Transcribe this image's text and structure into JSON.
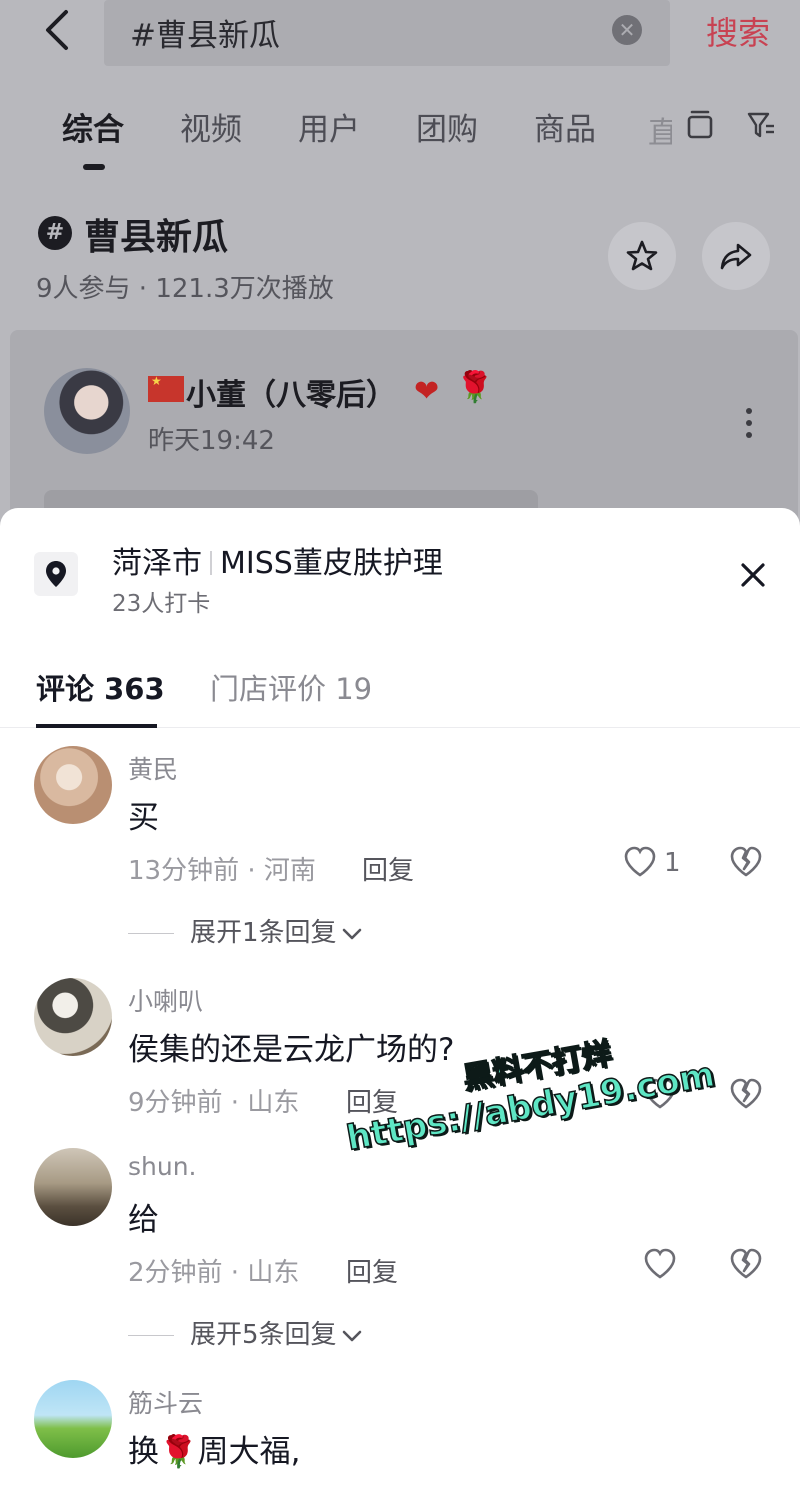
{
  "header": {
    "search_query": "#曹县新瓜",
    "search_button": "搜索",
    "brand_color": "#c84252"
  },
  "tabs": [
    {
      "label": "综合",
      "active": true
    },
    {
      "label": "视频",
      "active": false
    },
    {
      "label": "用户",
      "active": false
    },
    {
      "label": "团购",
      "active": false
    },
    {
      "label": "商品",
      "active": false
    }
  ],
  "tabs_overflow_label": "直",
  "topic": {
    "icon": "hashtag-icon",
    "title": "曹县新瓜",
    "stats": "9人参与 · 121.3万次播放"
  },
  "post": {
    "author": "小董（八零后）",
    "author_emoji": [
      "❤",
      "🌹"
    ],
    "time": "昨天19:42"
  },
  "sheet": {
    "place_city": "菏泽市",
    "place_name": "MISS董皮肤护理",
    "checkins": "23人打卡",
    "tabs": [
      {
        "label": "评论 363",
        "active": true
      },
      {
        "label": "门店评价 19",
        "active": false
      }
    ]
  },
  "comments": [
    {
      "user": "黄民",
      "text": "买",
      "meta": "13分钟前 · 河南",
      "reply_label": "回复",
      "likes": "1",
      "expand": "展开1条回复"
    },
    {
      "user": "小喇叭",
      "text": "侯集的还是云龙广场的?",
      "meta": "9分钟前 · 山东",
      "reply_label": "回复",
      "likes": "",
      "expand": ""
    },
    {
      "user": "shun.",
      "text": "给",
      "meta": "2分钟前 · 山东",
      "reply_label": "回复",
      "likes": "",
      "expand": "展开5条回复"
    },
    {
      "user": "筋斗云",
      "text_before": "换",
      "text_emoji": "🌹",
      "text_after": "周大福,",
      "meta": "",
      "reply_label": "",
      "likes": "",
      "expand": ""
    }
  ],
  "watermark": {
    "line1": "黑料不打烊",
    "line2": "https://abdy19.com",
    "color": "#5ee6c4"
  }
}
